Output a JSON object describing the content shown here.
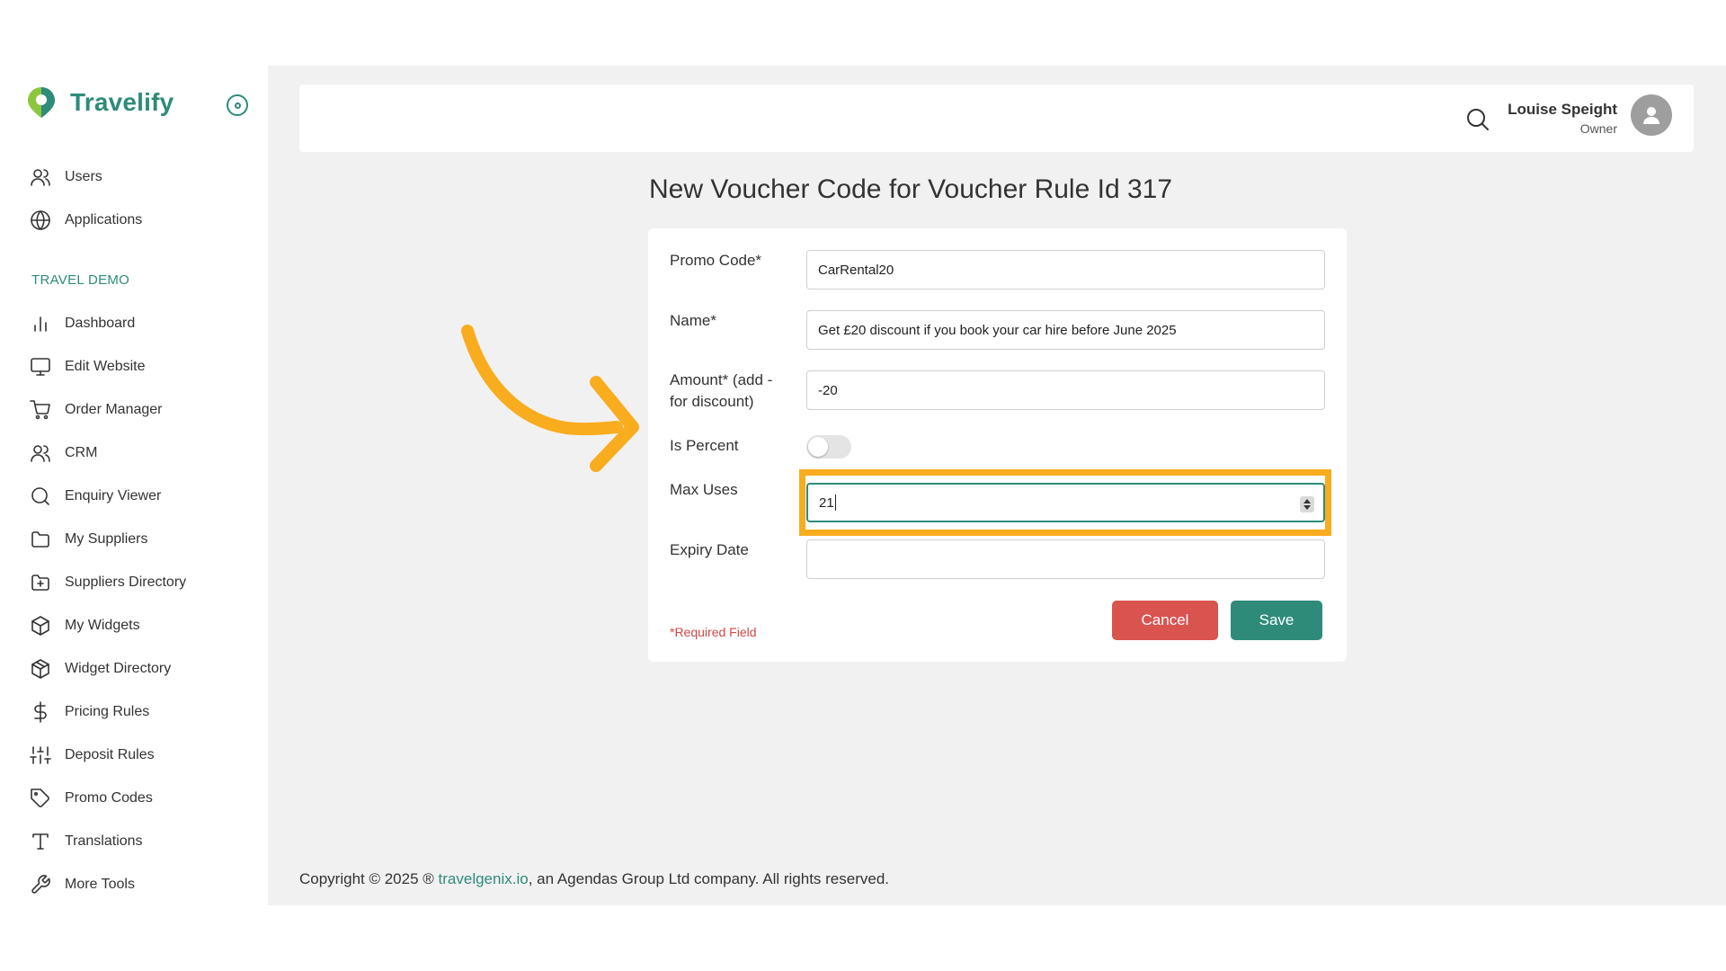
{
  "brand": {
    "name": "Travelify",
    "color": "#2e8b7a"
  },
  "sidebar": {
    "top_items": [
      {
        "label": "Users",
        "icon": "users-icon"
      },
      {
        "label": "Applications",
        "icon": "globe-icon"
      }
    ],
    "section_title": "TRAVEL DEMO",
    "items": [
      {
        "label": "Dashboard",
        "icon": "bar-chart-icon"
      },
      {
        "label": "Edit Website",
        "icon": "monitor-icon"
      },
      {
        "label": "Order Manager",
        "icon": "cart-icon"
      },
      {
        "label": "CRM",
        "icon": "users-icon"
      },
      {
        "label": "Enquiry Viewer",
        "icon": "search-icon"
      },
      {
        "label": "My Suppliers",
        "icon": "folder-icon"
      },
      {
        "label": "Suppliers Directory",
        "icon": "folder-plus-icon"
      },
      {
        "label": "My Widgets",
        "icon": "box-icon"
      },
      {
        "label": "Widget Directory",
        "icon": "boxes-icon"
      },
      {
        "label": "Pricing Rules",
        "icon": "dollar-icon"
      },
      {
        "label": "Deposit Rules",
        "icon": "sliders-icon"
      },
      {
        "label": "Promo Codes",
        "icon": "tag-icon"
      },
      {
        "label": "Translations",
        "icon": "type-icon"
      },
      {
        "label": "More Tools",
        "icon": "wrench-icon"
      }
    ]
  },
  "header": {
    "user_name": "Louise Speight",
    "user_role": "Owner"
  },
  "page": {
    "title": "New Voucher Code for Voucher Rule Id 317"
  },
  "form": {
    "promo_code_label": "Promo Code*",
    "promo_code_value": "CarRental20",
    "name_label": "Name*",
    "name_value": "Get £20 discount if you book your car hire before June 2025",
    "amount_label": "Amount* (add - for discount)",
    "amount_value": "-20",
    "is_percent_label": "Is Percent",
    "is_percent_on": false,
    "max_uses_label": "Max Uses",
    "max_uses_value": "21",
    "expiry_label": "Expiry Date",
    "expiry_value": "",
    "required_note": "*Required Field",
    "cancel_label": "Cancel",
    "save_label": "Save"
  },
  "annotation": {
    "highlight_color": "#f9ac1d"
  },
  "footer": {
    "prefix": "Copyright © 2025 ® ",
    "link": "travelgenix.io",
    "suffix": ", an Agendas Group Ltd company. All rights reserved."
  }
}
